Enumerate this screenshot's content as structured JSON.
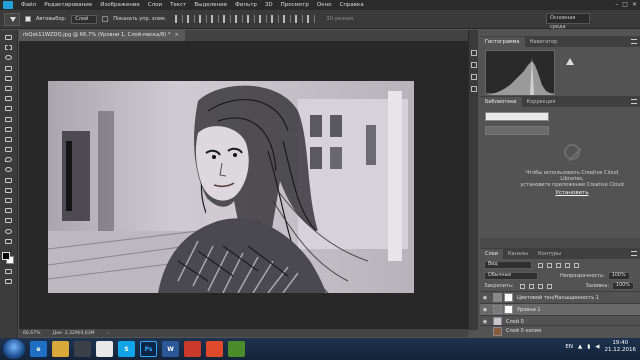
{
  "menubar": {
    "items": [
      "Файл",
      "Редактирование",
      "Изображение",
      "Слои",
      "Текст",
      "Выделение",
      "Фильтр",
      "3D",
      "Просмотр",
      "Окно",
      "Справка"
    ]
  },
  "options": {
    "auto_select_label": "Автовыбор:",
    "auto_select_value": "Слой",
    "show_transform_label": "Показать упр. элем.",
    "mode_3d": "3D-режим:",
    "workspace_value": "Основная среда"
  },
  "document": {
    "tab_title": "rbQsk11WZDQ.jpg @ 66,7% (Уровни 1, Слой-маска/8) *",
    "tab_close": "×",
    "zoom": "66,67%",
    "doc_info": "Док: 2,32M/4,63M",
    "status_arrow": "›"
  },
  "histogram": {
    "tabs": [
      "Гистограмма",
      "Навигатор"
    ]
  },
  "libraries": {
    "tabs": [
      "Библиотеки",
      "Коррекция"
    ],
    "message_line1": "Чтобы использовать Creative Cloud",
    "message_line2": "Libraries,",
    "message_line3": "установите приложение Creative Cloud",
    "install_label": "Установить"
  },
  "layers_panel": {
    "tabs": [
      "Слои",
      "Каналы",
      "Контуры"
    ],
    "kind_filter": "Вид",
    "blend_mode": "Обычные",
    "opacity_label": "Непрозрачность:",
    "opacity_value": "100%",
    "lock_label": "Закрепить:",
    "fill_label": "Заливка:",
    "fill_value": "100%",
    "layers": [
      {
        "name": "Цветовой тон/Насыщенность 1"
      },
      {
        "name": "Уровни 1"
      },
      {
        "name": "Слой 0"
      },
      {
        "name": "Слой 0 копия"
      }
    ]
  },
  "taskbar": {
    "apps": [
      "e",
      "",
      "",
      "",
      "S",
      "Ps",
      "W",
      "",
      "",
      ""
    ],
    "lang": "EN",
    "time": "19:40",
    "date": "21.12.2016"
  },
  "colors": {
    "accent": "#26a0da",
    "workspace_bg": "#282828",
    "panel_bg": "#535353",
    "taskbar": "#1e3350"
  }
}
